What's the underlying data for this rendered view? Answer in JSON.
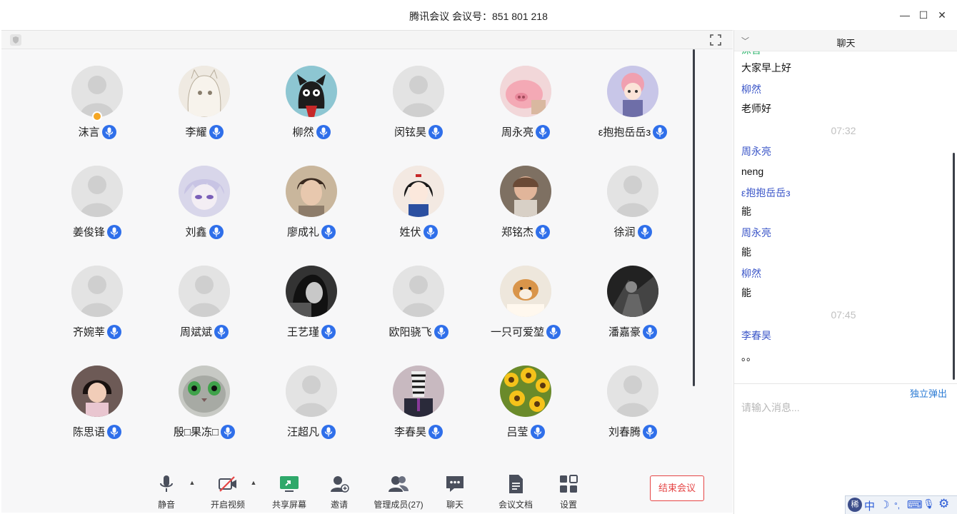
{
  "window": {
    "title": "腾讯会议 会议号：851 801 218",
    "minimize_glyph": "—",
    "maximize_glyph": "☐",
    "close_glyph": "✕"
  },
  "participants": [
    {
      "name": "沫言",
      "avatar": "default",
      "host": true
    },
    {
      "name": "李耀",
      "avatar": "sketch-girl"
    },
    {
      "name": "柳然",
      "avatar": "black-cat"
    },
    {
      "name": "闵铉昊",
      "avatar": "default"
    },
    {
      "name": "周永亮",
      "avatar": "pink-pig"
    },
    {
      "name": "ε抱抱岳岳з",
      "avatar": "anime-girl"
    },
    {
      "name": "姜俊锋",
      "avatar": "default"
    },
    {
      "name": "刘鑫",
      "avatar": "anime-boy"
    },
    {
      "name": "廖成礼",
      "avatar": "young-man"
    },
    {
      "name": "姓伏",
      "avatar": "snow-white"
    },
    {
      "name": "郑铭杰",
      "avatar": "child"
    },
    {
      "name": "徐润",
      "avatar": "default"
    },
    {
      "name": "齐婉莘",
      "avatar": "default"
    },
    {
      "name": "周斌斌",
      "avatar": "default"
    },
    {
      "name": "王艺瑾",
      "avatar": "bw-woman"
    },
    {
      "name": "欧阳骁飞",
      "avatar": "default"
    },
    {
      "name": "一只可爱堃",
      "avatar": "shiba-dog"
    },
    {
      "name": "潘嘉豪",
      "avatar": "dark-figure"
    },
    {
      "name": "陈思语",
      "avatar": "little-girl"
    },
    {
      "name": "殷□果冻□",
      "avatar": "cat-face"
    },
    {
      "name": "汪超凡",
      "avatar": "default"
    },
    {
      "name": "李春昊",
      "avatar": "zebra-man"
    },
    {
      "name": "吕莹",
      "avatar": "sunflowers"
    },
    {
      "name": "刘春腾",
      "avatar": "default",
      "mic_active": true
    }
  ],
  "toolbar": {
    "mute": "静音",
    "video": "开启视频",
    "share": "共享屏幕",
    "invite": "邀请",
    "members": "管理成员(27)",
    "chat": "聊天",
    "docs": "会议文档",
    "settings": "设置",
    "end": "结束会议"
  },
  "chat": {
    "title": "聊天",
    "messages": [
      {
        "kind": "sender",
        "text": "沫言",
        "color": "green"
      },
      {
        "kind": "text",
        "text": "大家早上好"
      },
      {
        "kind": "sender",
        "text": "柳然"
      },
      {
        "kind": "text",
        "text": "老师好"
      },
      {
        "kind": "time",
        "text": "07:32"
      },
      {
        "kind": "sender",
        "text": "周永亮"
      },
      {
        "kind": "text",
        "text": "neng"
      },
      {
        "kind": "sender",
        "text": "ε抱抱岳岳з"
      },
      {
        "kind": "text",
        "text": "能"
      },
      {
        "kind": "sender",
        "text": "周永亮"
      },
      {
        "kind": "text",
        "text": "能"
      },
      {
        "kind": "sender",
        "text": "柳然"
      },
      {
        "kind": "text",
        "text": "能"
      },
      {
        "kind": "time",
        "text": "07:45"
      },
      {
        "kind": "sender",
        "text": "李春昊"
      },
      {
        "kind": "text",
        "text": "。。"
      }
    ],
    "popout": "独立弹出",
    "input_placeholder": "请输入消息..."
  },
  "ime": {
    "logo": "稀",
    "lang": "中",
    "moon": "☽",
    "punct": "°,",
    "keyboard": "⌨",
    "mic": "🎙",
    "gear": "⚙"
  },
  "colors": {
    "accent": "#2f6fea",
    "end_red": "#e54545",
    "sender_blue": "#3b56c8",
    "host_green": "#2ab36a"
  }
}
